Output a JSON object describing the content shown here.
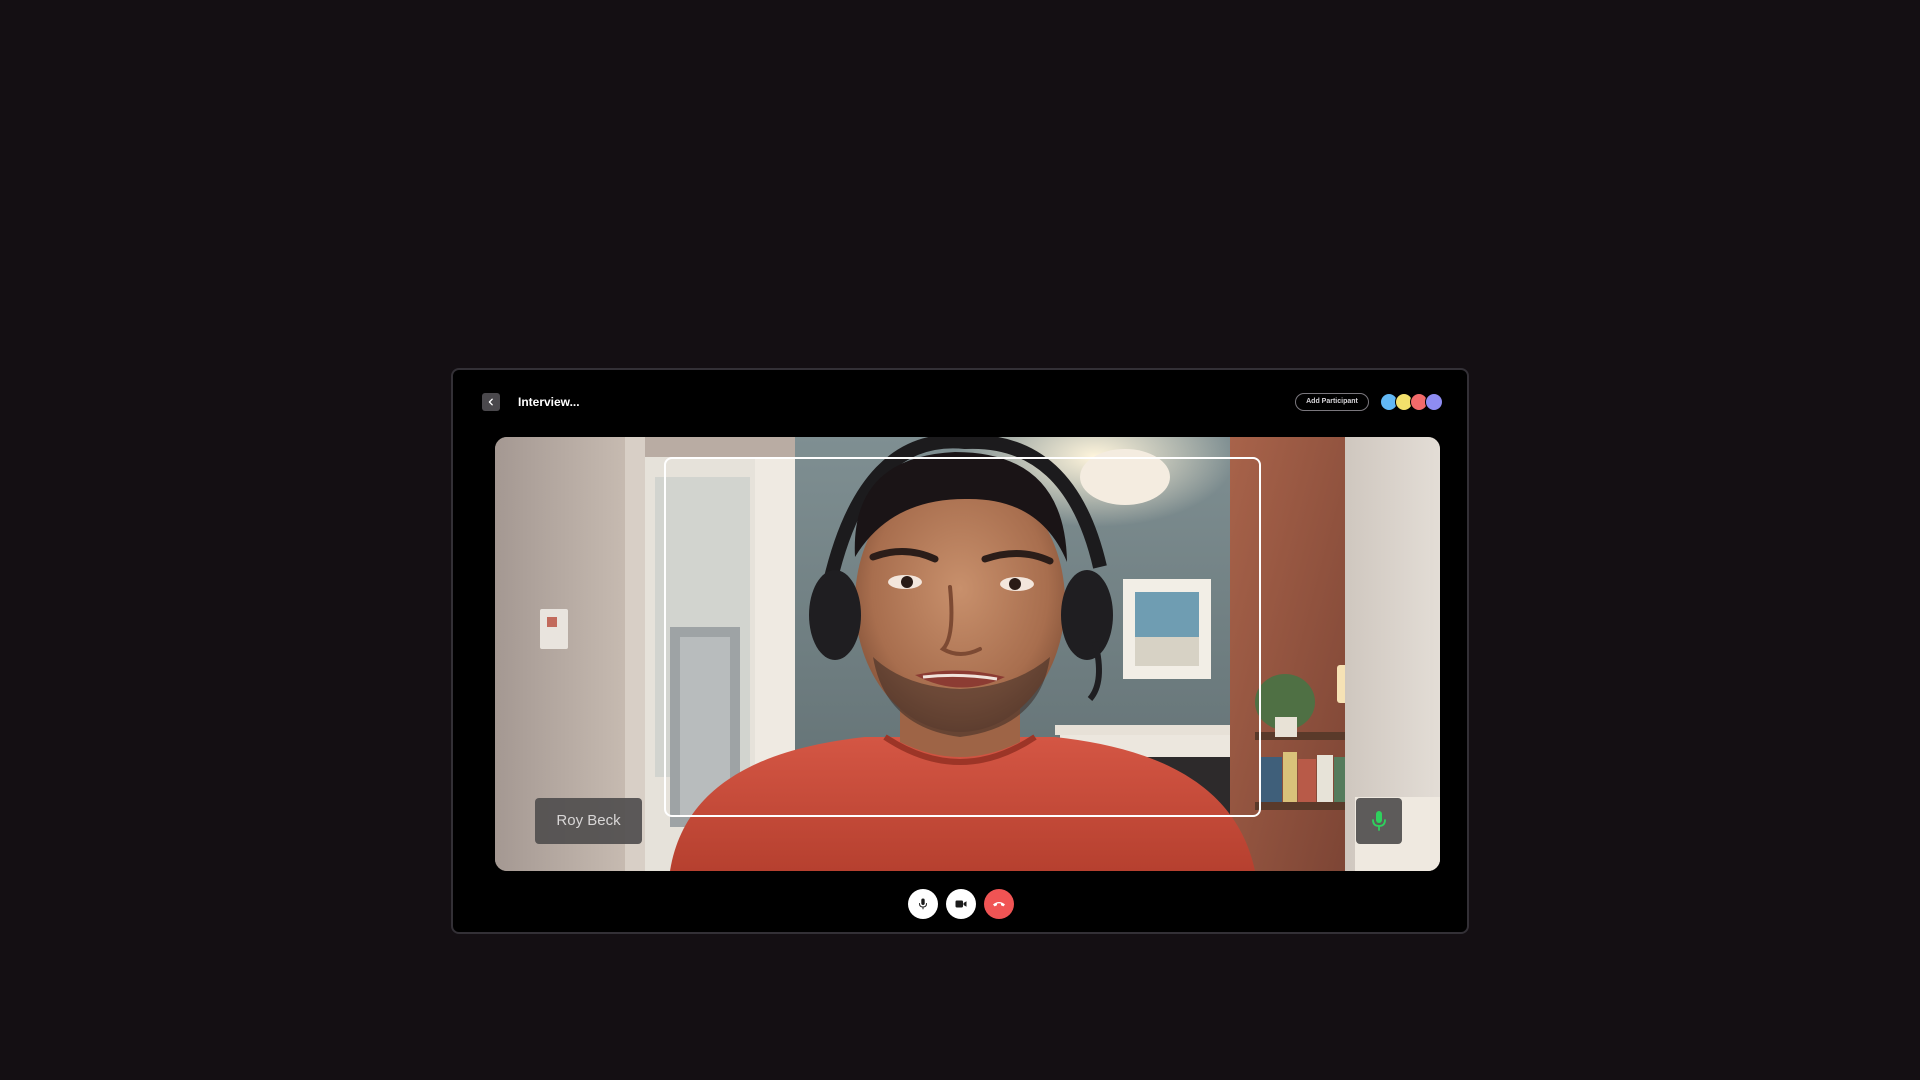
{
  "header": {
    "back_icon": "chevron-left-icon",
    "title": "Interview...",
    "add_participant_label": "Add Participant"
  },
  "participants": [
    {
      "initial": "",
      "color": "#62b8f5"
    },
    {
      "initial": "",
      "color": "#f3e06b"
    },
    {
      "initial": "",
      "color": "#f26a6a"
    },
    {
      "initial": "",
      "color": "#8e8cf2"
    }
  ],
  "video": {
    "participant_name": "Roy Beck",
    "mic_status_icon": "microphone-icon",
    "mic_active_color": "#2ed15d"
  },
  "controls": {
    "mute_icon": "microphone-icon",
    "camera_icon": "video-camera-icon",
    "end_call_icon": "phone-hangup-icon",
    "end_call_color": "#f05454"
  }
}
